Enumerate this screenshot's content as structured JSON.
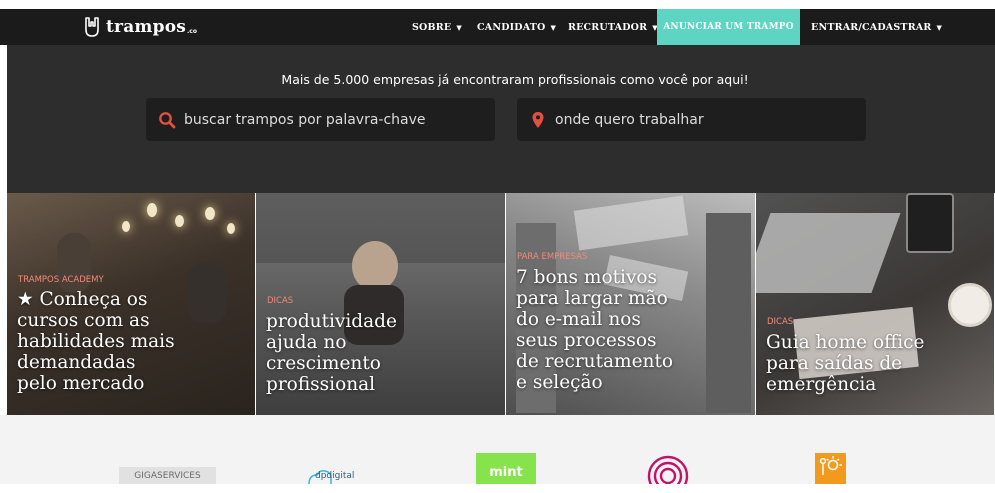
{
  "header": {
    "logo": {
      "name": "trampos",
      "suffix": ".co"
    },
    "nav": {
      "sobre": "SOBRE",
      "candidato": "CANDIDATO",
      "recrutador": "RECRUTADOR",
      "anunciar": "ANUNCIAR UM TRAMPO",
      "entrar": "ENTRAR/CADASTRAR"
    }
  },
  "hero": {
    "tagline": "Mais de 5.000 empresas já encontraram profissionais como você por aqui!",
    "search": {
      "keyword_placeholder": "buscar trampos por palavra-chave",
      "location_placeholder": "onde quero trabalhar"
    }
  },
  "cards": [
    {
      "tag": "TRAMPOS ACADEMY",
      "title_lines": [
        "★ Conheça os",
        "cursos com as",
        "habilidades mais",
        "demandadas",
        "pelo mercado"
      ]
    },
    {
      "tag": "DICAS",
      "title_lines": [
        "produtividade",
        "ajuda no",
        "crescimento",
        "profissional"
      ]
    },
    {
      "tag": "PARA EMPRESAS",
      "title_lines": [
        "7 bons motivos",
        "para largar mão",
        "do e-mail nos",
        "seus processos",
        "de recrutamento",
        "e seleção"
      ]
    },
    {
      "tag": "DICAS",
      "title_lines": [
        "Guia home office",
        "para saídas de",
        "emergência"
      ]
    }
  ],
  "partners": {
    "giga": "GIGASERVICES",
    "digital": "dpdigital",
    "mint": "mint"
  },
  "colors": {
    "topbar": "#1b1b1b",
    "accent": "#5ed4c2",
    "hero_bg": "#2d2d2d",
    "search_bg": "#1e1e1e",
    "search_icon": "#e2503e",
    "tag": "#f08a78"
  },
  "icons": {
    "logo": "hand-horns-icon",
    "search": "search-icon",
    "location": "map-pin-icon",
    "caret": "caret-down-icon"
  }
}
